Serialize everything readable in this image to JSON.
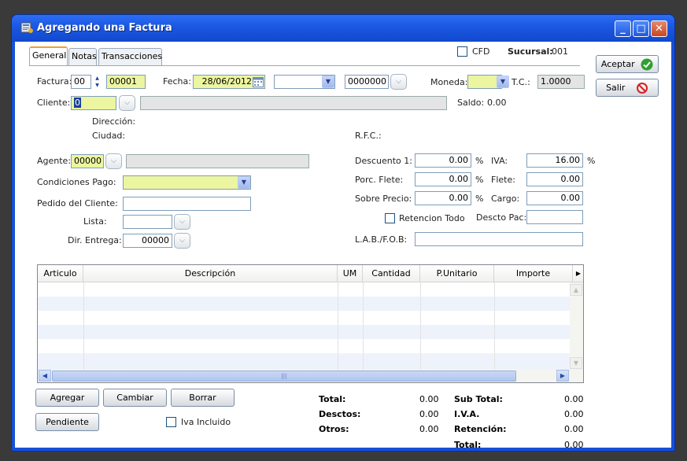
{
  "window": {
    "title": "Agregando una Factura"
  },
  "tabs": [
    "General",
    "Notas",
    "Transacciones"
  ],
  "header": {
    "cfd_label": "CFD",
    "sucursal_label": "Sucursal:",
    "sucursal_value": "001"
  },
  "buttons": {
    "aceptar": "Aceptar",
    "salir": "Salir",
    "agregar": "Agregar",
    "cambiar": "Cambiar",
    "borrar": "Borrar",
    "pendiente": "Pendiente"
  },
  "form": {
    "factura_label": "Factura:",
    "factura_serie": "00",
    "factura_num": "00001",
    "fecha_label": "Fecha:",
    "fecha_value": "28/06/2012",
    "numero_value": "0000000",
    "moneda_label": "Moneda:",
    "tc_label": "T.C.:",
    "tc_value": "1.0000",
    "cliente_label": "Cliente:",
    "cliente_value": "0",
    "saldo_label": "Saldo:",
    "saldo_value": "0.00",
    "direccion_label": "Dirección:",
    "ciudad_label": "Ciudad:",
    "rfc_label": "R.F.C.:",
    "agente_label": "Agente:",
    "agente_value": "00000",
    "condiciones_label": "Condiciones Pago:",
    "pedido_label": "Pedido del Cliente:",
    "lista_label": "Lista:",
    "dir_entrega_label": "Dir. Entrega:",
    "dir_entrega_value": "00000",
    "descuento_label": "Descuento 1:",
    "descuento_value": "0.00",
    "flete_pct_label": "Porc. Flete:",
    "flete_pct_value": "0.00",
    "sobreprecio_label": "Sobre Precio:",
    "sobreprecio_value": "0.00",
    "pct_symbol": "%",
    "iva_label": "IVA:",
    "iva_value": "16.00",
    "flete_label": "Flete:",
    "flete_value": "0.00",
    "cargo_label": "Cargo:",
    "cargo_value": "0.00",
    "retencion_todo_label": "Retencion Todo",
    "descto_pac_label": "Descto Pac:",
    "lab_label": "L.A.B./F.O.B:",
    "iva_incluido_label": "Iva Incluido"
  },
  "grid": {
    "columns": [
      "Articulo",
      "Descripción",
      "UM",
      "Cantidad",
      "P.Unitario",
      "Importe"
    ]
  },
  "totals": {
    "total_label": "Total:",
    "total_value": "0.00",
    "desctos_label": "Desctos:",
    "desctos_value": "0.00",
    "otros_label": "Otros:",
    "otros_value": "0.00",
    "subtotal_label": "Sub Total:",
    "subtotal_value": "0.00",
    "iva_label": "I.V.A.",
    "iva_value": "0.00",
    "retencion_label": "Retención:",
    "retencion_value": "0.00",
    "total2_label": "Total:",
    "total2_value": "0.00"
  }
}
